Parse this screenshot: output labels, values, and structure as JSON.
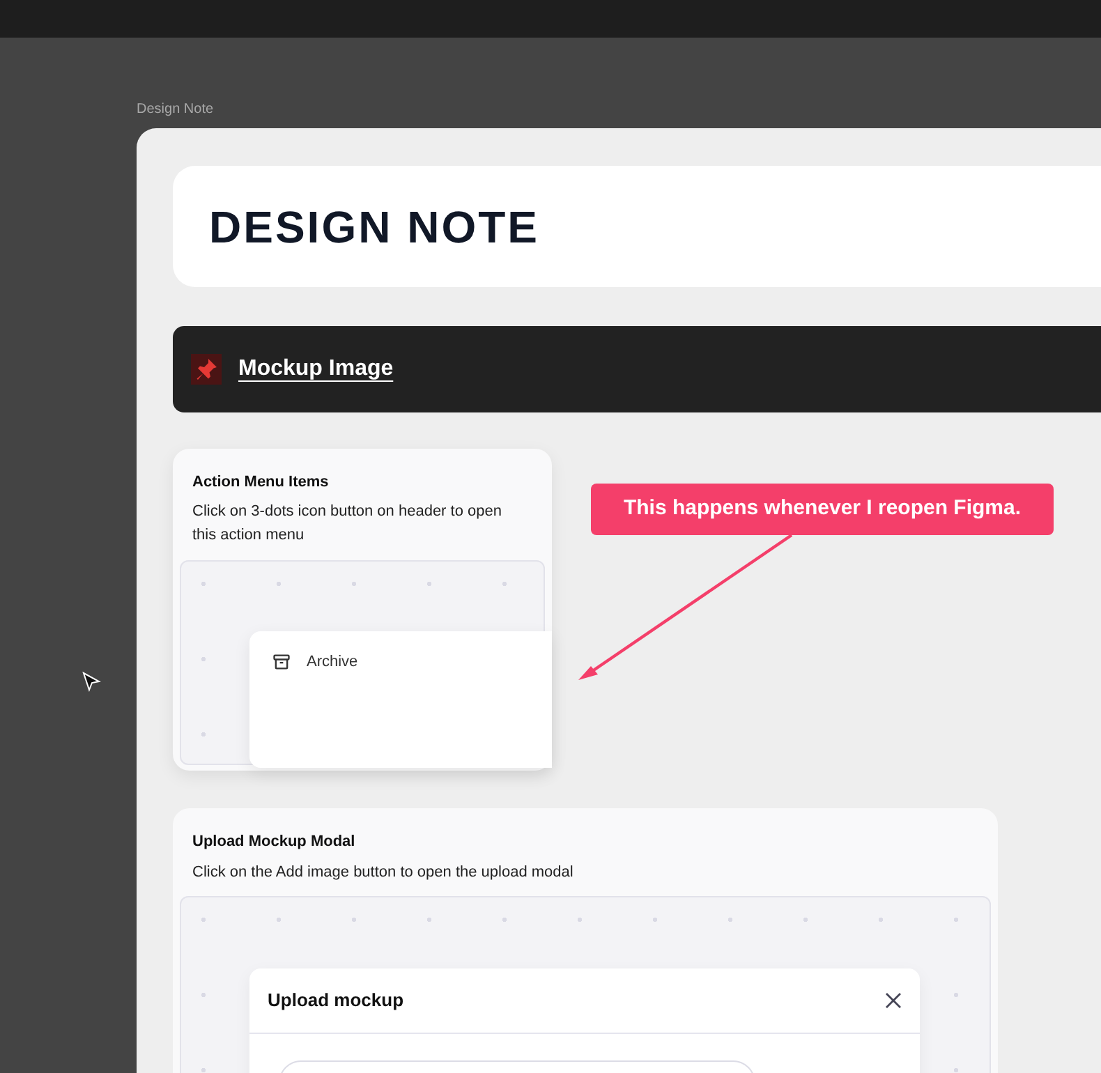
{
  "frame_label": "Design Note",
  "title": "DESIGN NOTE",
  "section": {
    "title": "Mockup Image"
  },
  "cards": [
    {
      "kind": "menu",
      "title": "Action Menu Items",
      "description": "Click on 3-dots icon button on header to open this action menu",
      "menu_items": [
        "Archive"
      ]
    },
    {
      "kind": "modal",
      "title": "Upload Mockup Modal",
      "description": "Click on the Add image button to open the upload modal",
      "modal_title": "Upload mockup"
    }
  ],
  "callout": {
    "text": "This happens whenever I reopen Figma."
  }
}
